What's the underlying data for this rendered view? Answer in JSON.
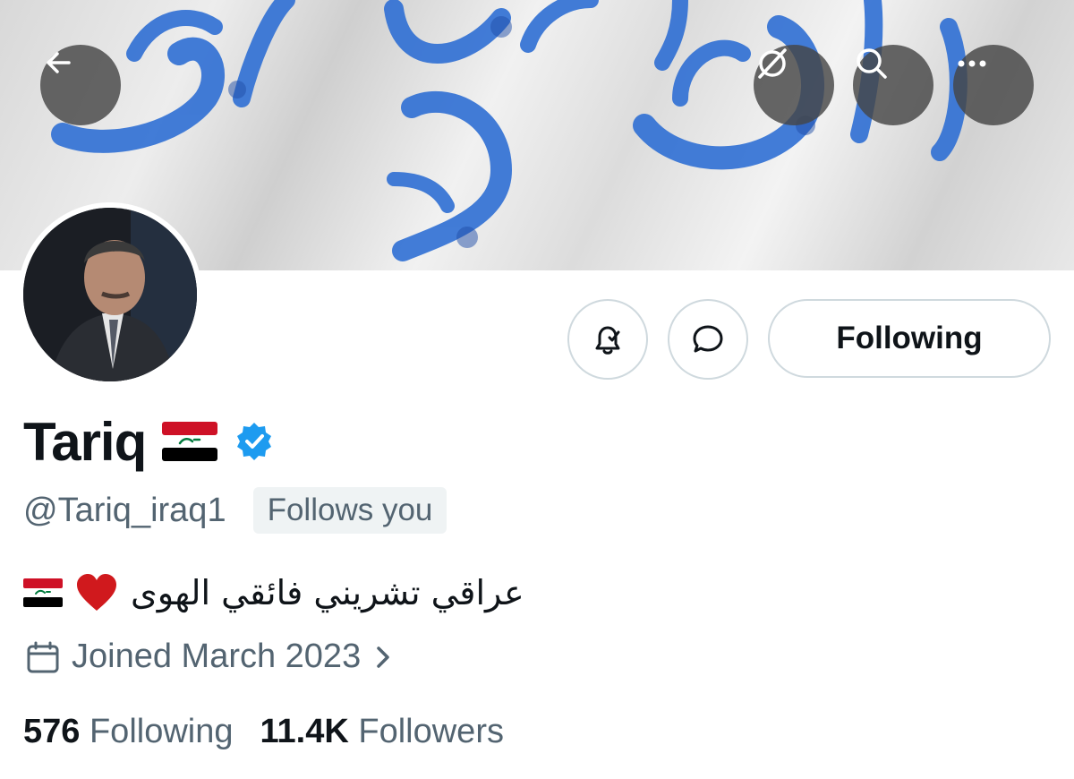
{
  "header": {
    "back_icon": "arrow-left-icon",
    "translate_icon": "hide-translate-icon",
    "search_icon": "search-icon",
    "more_icon": "more-horizontal-icon"
  },
  "actions": {
    "notify_icon": "bell-check-icon",
    "message_icon": "message-bubble-icon",
    "following_label": "Following"
  },
  "profile": {
    "name": "Tariq",
    "name_flag": "iraq-flag",
    "verified": true,
    "handle": "@Tariq_iraq1",
    "follows_you": "Follows you",
    "bio": "عراقي تشريني فائقي الهوى",
    "bio_emojis": [
      "iraq-flag",
      "red-heart"
    ],
    "joined": "Joined March 2023"
  },
  "stats": {
    "following_count": "576",
    "following_label": "Following",
    "followers_count": "11.4K",
    "followers_label": "Followers"
  },
  "colors": {
    "verified_blue": "#1d9bf0",
    "text_primary": "#0f1419",
    "text_secondary": "#536471",
    "border": "#cfd9de"
  }
}
